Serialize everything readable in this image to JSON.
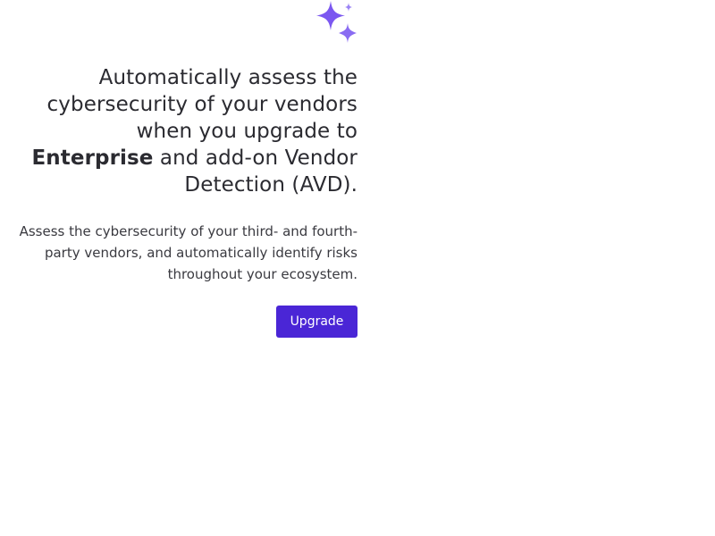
{
  "promo": {
    "icon": "sparkles-icon",
    "headline_part1": "Automatically assess the cybersecurity of your vendors when you upgrade to ",
    "headline_emphasis": "Enterprise",
    "headline_part2": " and add-on Vendor Detection (AVD).",
    "description": "Assess the cybersecurity of your third- and fourth-party vendors, and automatically identify risks throughout your ecosystem.",
    "upgrade_label": "Upgrade"
  },
  "colors": {
    "accent": "#4a26d6",
    "sparkle_primary": "#7b57f0",
    "sparkle_secondary": "#9b84f5",
    "text": "#2b2b31",
    "background": "#ffffff"
  }
}
